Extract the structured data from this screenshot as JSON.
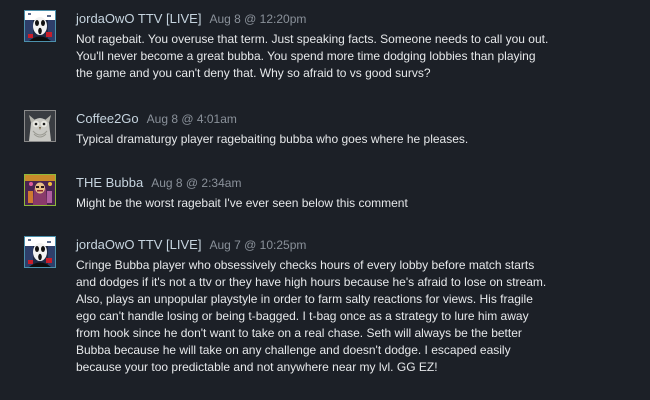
{
  "comments": [
    {
      "author": "jordaOwO TTV [LIVE]",
      "date": "Aug 8 @ 12:20pm",
      "avatar_icon": "ghostface-avatar",
      "status_color": "#4c91ac",
      "lines": [
        "Not ragebait. You overuse that term. Just speaking facts. Someone needs to call you out.",
        "You'll never become a great bubba. You spend more time dodging lobbies than playing",
        "the game and you can't deny that. Why so afraid to vs good survs?"
      ]
    },
    {
      "author": "Coffee2Go",
      "date": "Aug 8 @ 4:01am",
      "avatar_icon": "owl-avatar",
      "status_color": "#8a8a8a",
      "lines": [
        "Typical dramaturgy player ragebaiting bubba who goes where he pleases."
      ]
    },
    {
      "author": "THE Bubba",
      "date": "Aug 8 @ 2:34am",
      "avatar_icon": "bubba-avatar",
      "status_color": "#8fb93b",
      "lines": [
        "Might be the worst ragebait I've ever seen below this comment"
      ]
    },
    {
      "author": "jordaOwO TTV [LIVE]",
      "date": "Aug 7 @ 10:25pm",
      "avatar_icon": "ghostface-avatar",
      "status_color": "#4c91ac",
      "lines": [
        "Cringe Bubba player who obsessively checks hours of every lobby before match starts",
        "and dodges if it's not a ttv or they have high hours because he's afraid to lose on stream.",
        "Also, plays an unpopular playstyle in order to farm salty reactions for views. His fragile",
        "ego can't handle losing or being t-bagged. I t-bag once as a strategy to lure him away",
        "from hook since he don't want to take on a real chase. Seth will always be the better",
        "Bubba because he will take on any challenge and doesn't dodge. I escaped easily",
        "because your too predictable and not anywhere near my lvl. GG EZ!"
      ]
    }
  ]
}
